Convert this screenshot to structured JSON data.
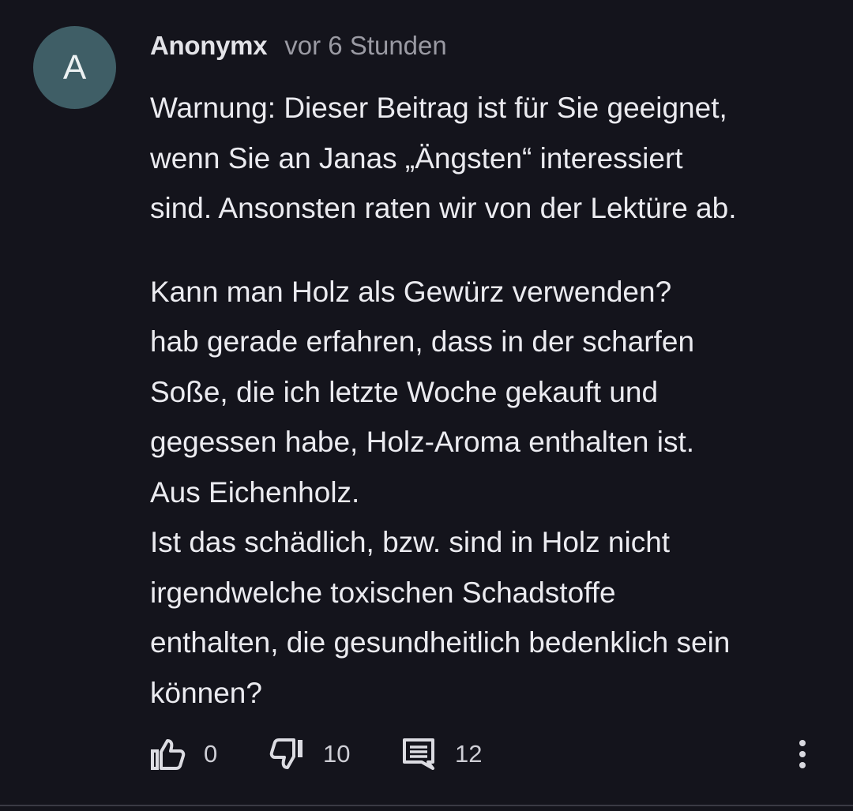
{
  "comment": {
    "avatar_letter": "A",
    "author": "Anonymx",
    "timestamp": "vor 6 Stunden",
    "body_lines": [
      "Warnung: Dieser Beitrag ist für Sie geeignet,",
      "wenn Sie an Janas „Ängsten“ interessiert",
      "sind. Ansonsten raten wir von der Lektüre ab.",
      "",
      "Kann man Holz als Gewürz verwenden?",
      "hab gerade erfahren, dass in der scharfen",
      "Soße, die ich letzte Woche gekauft und",
      "gegessen habe, Holz-Aroma enthalten ist.",
      "Aus Eichenholz.",
      "Ist das schädlich, bzw. sind in Holz nicht",
      "irgendwelche toxischen Schadstoffe",
      "enthalten, die gesundheitlich bedenklich sein",
      "können?"
    ],
    "actions": {
      "like_icon": "thumbs-up-icon",
      "like_count": "0",
      "dislike_icon": "thumbs-down-icon",
      "dislike_count": "10",
      "reply_icon": "comment-icon",
      "reply_count": "12",
      "more_icon": "more-vertical-icon"
    }
  },
  "colors": {
    "background": "#14141c",
    "avatar": "#3f5e66",
    "text": "#ebebf0",
    "muted_text": "#9a9aa3",
    "divider": "#3a3a44"
  }
}
